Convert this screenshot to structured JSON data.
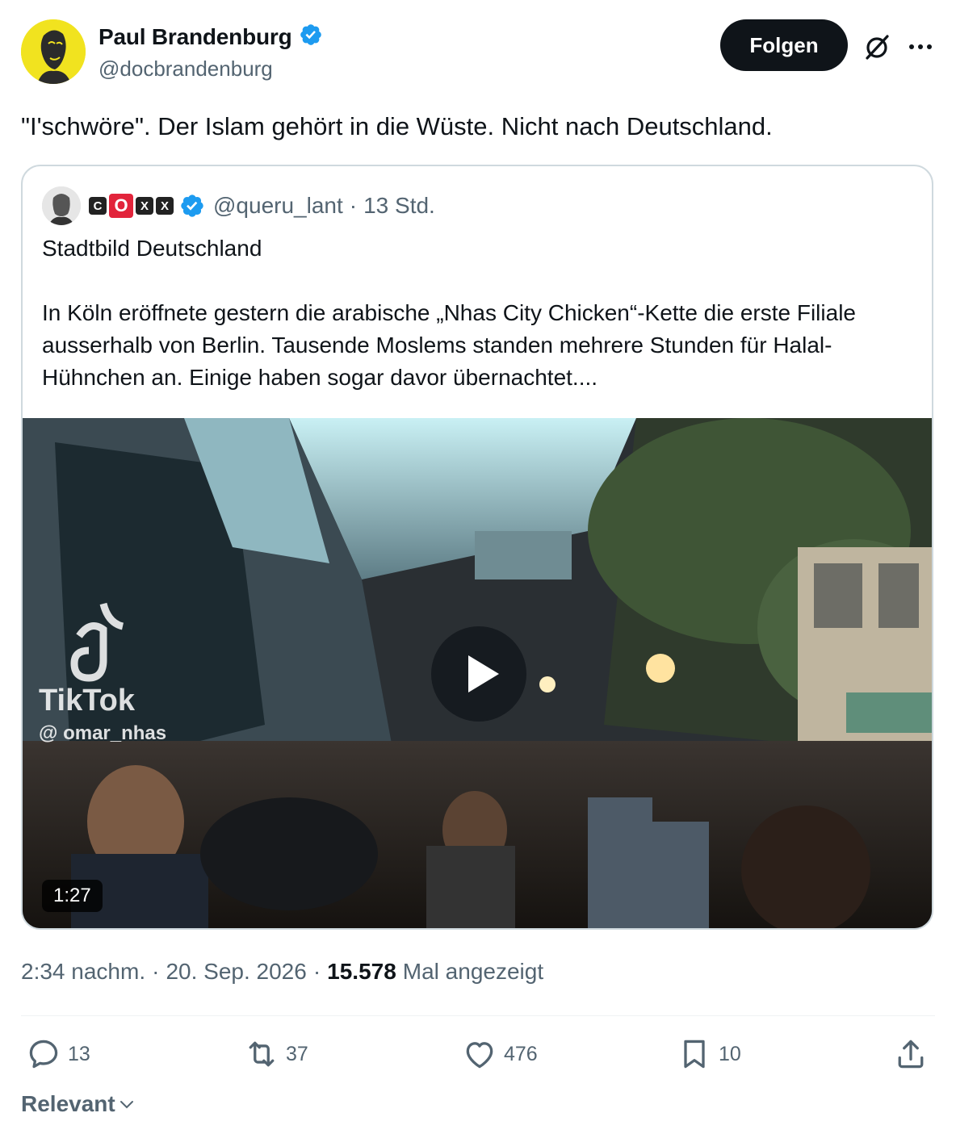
{
  "author": {
    "name": "Paul Brandenburg",
    "handle": "@docbrandenburg",
    "follow_label": "Folgen",
    "verified_color": "#1d9bf0"
  },
  "tweet": {
    "text": "\"I'schwöre\". Der Islam gehört in die Wüste. Nicht nach Deutschland."
  },
  "quoted": {
    "emoji_badges": [
      "C",
      "O",
      "X",
      "X"
    ],
    "handle": "@queru_lant",
    "separator": "·",
    "time": "13 Std.",
    "title": "Stadtbild Deutschland",
    "body": "In Köln eröffnete gestern die arabische „Nhas City Chicken“-Kette die erste Filiale ausserhalb von Berlin. Tausende Moslems standen mehrere Stunden für Halal-Hühnchen an. Einige haben sogar davor übernachtet....",
    "video": {
      "duration": "1:27",
      "watermark_brand": "TikTok",
      "watermark_handle": "@ omar_nhas"
    }
  },
  "meta": {
    "time": "2:34 nachm.",
    "sep1": "·",
    "date": "20. Sep. 2026",
    "sep2": "·",
    "views": "15.578",
    "views_label": "Mal angezeigt"
  },
  "actions": {
    "replies": "13",
    "reposts": "37",
    "likes": "476",
    "bookmarks": "10"
  },
  "sort_label": "Relevant",
  "icons": [
    "verified-badge-icon",
    "grok-icon",
    "more-icon",
    "play-icon",
    "reply-icon",
    "repost-icon",
    "like-icon",
    "bookmark-icon",
    "share-icon",
    "chevron-down-icon"
  ]
}
